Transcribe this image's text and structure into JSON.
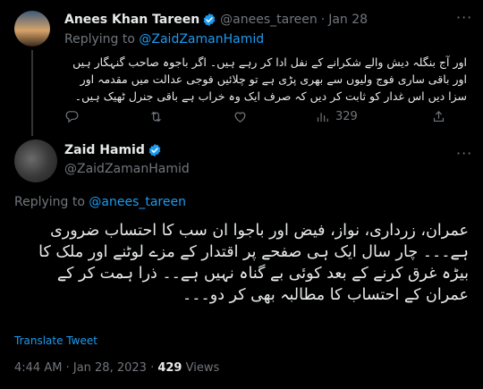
{
  "reply_tweet": {
    "author_name": "Anees Khan Tareen",
    "author_handle": "@anees_tareen",
    "separator": "·",
    "date": "Jan 28",
    "more_label": "···",
    "replying_prefix": "Replying to",
    "replying_handle": "@ZaidZamanHamid",
    "text": "اور آج بنگلہ دیش والے شکرانے کے نفل ادا کر رہے ہیں۔ اگر باجوہ صاحب گنہگار ہیں اور باقی ساری فوج ولیوں سے بھری پڑی ہے تو چلائیں فوجی عدالت میں مقدمہ اور سزا دیں اس غدار کو ثابت کر دیں کہ صرف ایک وہ خراب ہے باقی جنرل ٹھیک ہیں۔",
    "views": "329"
  },
  "main_tweet": {
    "author_name": "Zaid Hamid",
    "author_handle": "@ZaidZamanHamid",
    "more_label": "···",
    "replying_prefix": "Replying to",
    "replying_handle": "@anees_tareen",
    "text": "عمران، زرداری، نواز، فیض اور باجوا ان سب کا احتساب ضروری ہے۔۔۔ چار سال ایک ہی صفحے پر اقتدار کے مزے لوٹنے اور ملک کا بیڑہ غرق کرنے کے بعد کوئی بے گناہ نہیں ہے۔۔ ذرا ہمت کر کے عمران کے احتساب کا مطالبہ بھی کر دو۔۔۔",
    "translate_label": "Translate Tweet",
    "time": "4:44 AM",
    "separator": "·",
    "date": "Jan 28, 2023",
    "separator2": "·",
    "views_count": "429",
    "views_label": "Views"
  },
  "colors": {
    "background": "#000000",
    "text": "#e7e9ea",
    "muted": "#71767b",
    "link": "#1d9bf0",
    "verified_badge": "#1d9bf0"
  }
}
